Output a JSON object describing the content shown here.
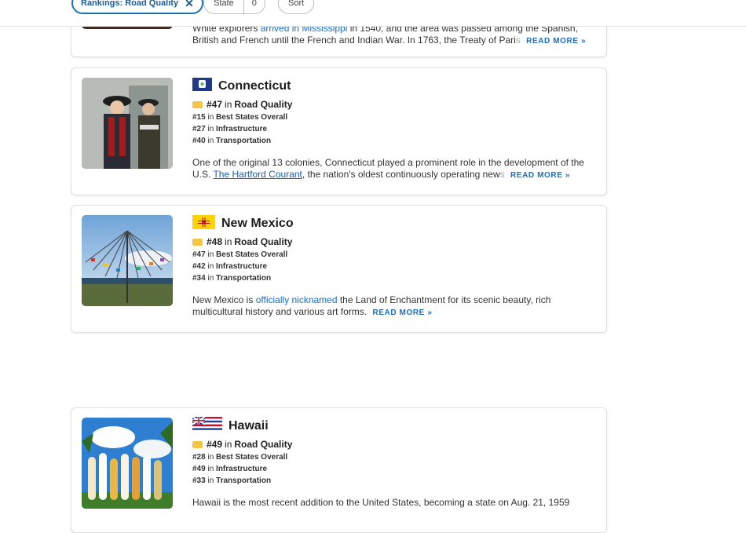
{
  "filters": {
    "active_chip_label": "Rankings: Road Quality",
    "active_chip_remove": "✕",
    "state_label": "State",
    "state_count": "0",
    "sort_label": "Sort"
  },
  "colors": {
    "link": "#1a6fc2",
    "chip_border": "#1a73b8",
    "badge": "#f5c542"
  },
  "cards": [
    {
      "name": "",
      "desc_pre": "White explorers ",
      "desc_link": "arrived in Mississippi",
      "desc_post": " in 1540, and the area was passed among the Spanish, British and French until the French and Indian War. In 1763, the Treaty of Pari",
      "desc_fade": "s",
      "read_more": "READ MORE »"
    },
    {
      "name": "Connecticut",
      "flag_icon": "connecticut-flag",
      "main_rank": "#47",
      "main_in": "in",
      "main_category": "Road Quality",
      "sub_ranks": [
        {
          "rank": "#15",
          "in": "in",
          "category": "Best States Overall"
        },
        {
          "rank": "#27",
          "in": "in",
          "category": "Infrastructure"
        },
        {
          "rank": "#40",
          "in": "in",
          "category": "Transportation"
        }
      ],
      "desc_pre": "One of the original 13 colonies, Connecticut played a prominent role in the development of the U.S. ",
      "desc_link": "The Hartford Courant",
      "desc_post": ", the nation's oldest continuously operating new",
      "desc_fade": "s",
      "read_more": "READ MORE »"
    },
    {
      "name": "New Mexico",
      "flag_icon": "new-mexico-flag",
      "main_rank": "#48",
      "main_in": "in",
      "main_category": "Road Quality",
      "sub_ranks": [
        {
          "rank": "#47",
          "in": "in",
          "category": "Best States Overall"
        },
        {
          "rank": "#42",
          "in": "in",
          "category": "Infrastructure"
        },
        {
          "rank": "#34",
          "in": "in",
          "category": "Transportation"
        }
      ],
      "desc_pre": "New Mexico is ",
      "desc_link": "officially nicknamed",
      "desc_post": " the Land of Enchantment for its scenic beauty, rich multicultural history and various art forms.",
      "read_more": "READ MORE »"
    },
    {
      "name": "Hawaii",
      "flag_icon": "hawaii-flag",
      "main_rank": "#49",
      "main_in": "in",
      "main_category": "Road Quality",
      "sub_ranks": [
        {
          "rank": "#28",
          "in": "in",
          "category": "Best States Overall"
        },
        {
          "rank": "#49",
          "in": "in",
          "category": "Infrastructure"
        },
        {
          "rank": "#33",
          "in": "in",
          "category": "Transportation"
        }
      ],
      "desc_pre": "Hawaii is the most recent addition to the United States, becoming a state on Aug. 21, 1959"
    }
  ]
}
